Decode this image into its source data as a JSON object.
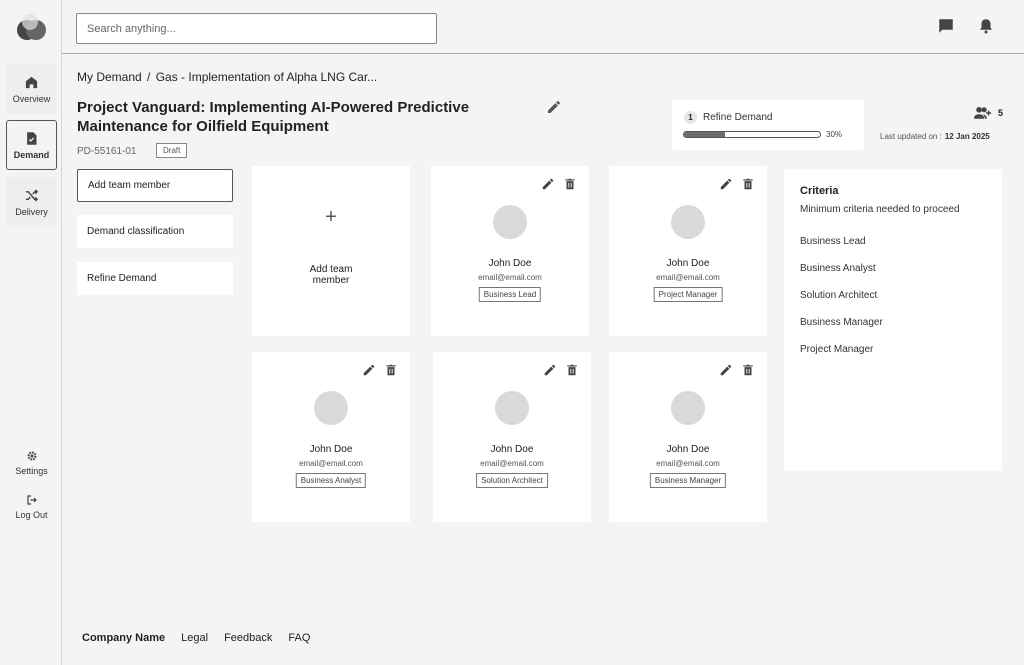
{
  "sidebar": {
    "items": [
      {
        "label": "Overview",
        "icon": "home-icon"
      },
      {
        "label": "Demand",
        "icon": "document-check-icon"
      },
      {
        "label": "Delivery",
        "icon": "shuffle-icon"
      }
    ],
    "bottom": [
      {
        "label": "Settings",
        "icon": "gear-icon"
      },
      {
        "label": "Log Out",
        "icon": "logout-icon"
      }
    ]
  },
  "search": {
    "placeholder": "Search anything..."
  },
  "breadcrumb": {
    "root": "My Demand",
    "separator": "/",
    "current": "Gas - Implementation of Alpha LNG Car..."
  },
  "project": {
    "title": "Project Vanguard: Implementing AI-Powered Predictive Maintenance for Oilfield Equipment",
    "id": "PD-55161-01",
    "status": "Draft"
  },
  "progress": {
    "step": "1",
    "label": "Refine Demand",
    "percent_text": "30%",
    "percent": 30
  },
  "team": {
    "count": "5"
  },
  "updated": {
    "label": "Last updated on :",
    "date": "12 Jan 2025"
  },
  "menu": [
    {
      "label": "Add team member"
    },
    {
      "label": "Demand classification"
    },
    {
      "label": "Refine Demand"
    }
  ],
  "add_card": {
    "plus": "+",
    "label_line1": "Add team",
    "label_line2": "member"
  },
  "members": [
    {
      "name": "John Doe",
      "email": "email@email.com",
      "role": "Business Lead"
    },
    {
      "name": "John Doe",
      "email": "email@email.com",
      "role": "Project Manager"
    },
    {
      "name": "John Doe",
      "email": "email@email.com",
      "role": "Business Analyst"
    },
    {
      "name": "John Doe",
      "email": "email@email.com",
      "role": "Solution Architect"
    },
    {
      "name": "John Doe",
      "email": "email@email.com",
      "role": "Business Manager"
    }
  ],
  "criteria": {
    "title": "Criteria",
    "subtitle": "Minimum criteria needed to proceed",
    "items": [
      "Business Lead",
      "Business Analyst",
      "Solution Architect",
      "Business Manager",
      "Project Manager"
    ]
  },
  "footer": {
    "company": "Company Name",
    "links": [
      "Legal",
      "Feedback",
      "FAQ"
    ]
  }
}
